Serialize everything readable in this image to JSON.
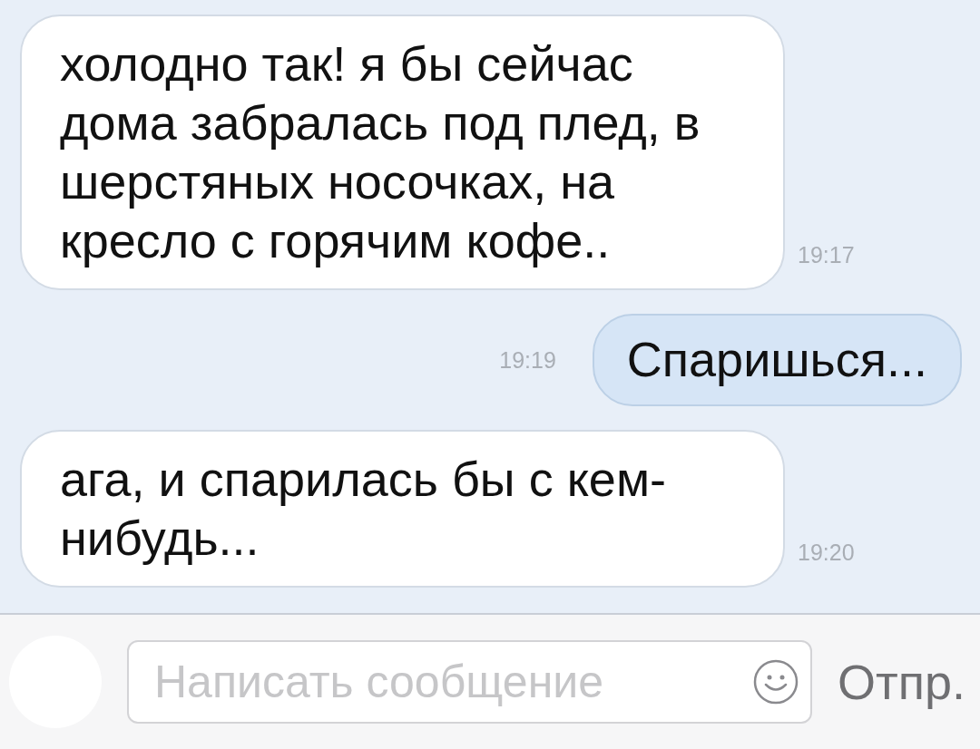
{
  "messages": [
    {
      "kind": "incoming",
      "text": "холодно так! я бы сейчас дома забралась под плед, в шерстяных носочках, на кресло с горячим кофе..",
      "time": "19:17"
    },
    {
      "kind": "outgoing",
      "text": "Спаришься...",
      "time": "19:19"
    },
    {
      "kind": "incoming",
      "text": "ага, и спарилась бы с кем-нибудь...",
      "time": "19:20"
    }
  ],
  "composer": {
    "placeholder": "Написать сообщение",
    "send_label": "Отпр."
  }
}
